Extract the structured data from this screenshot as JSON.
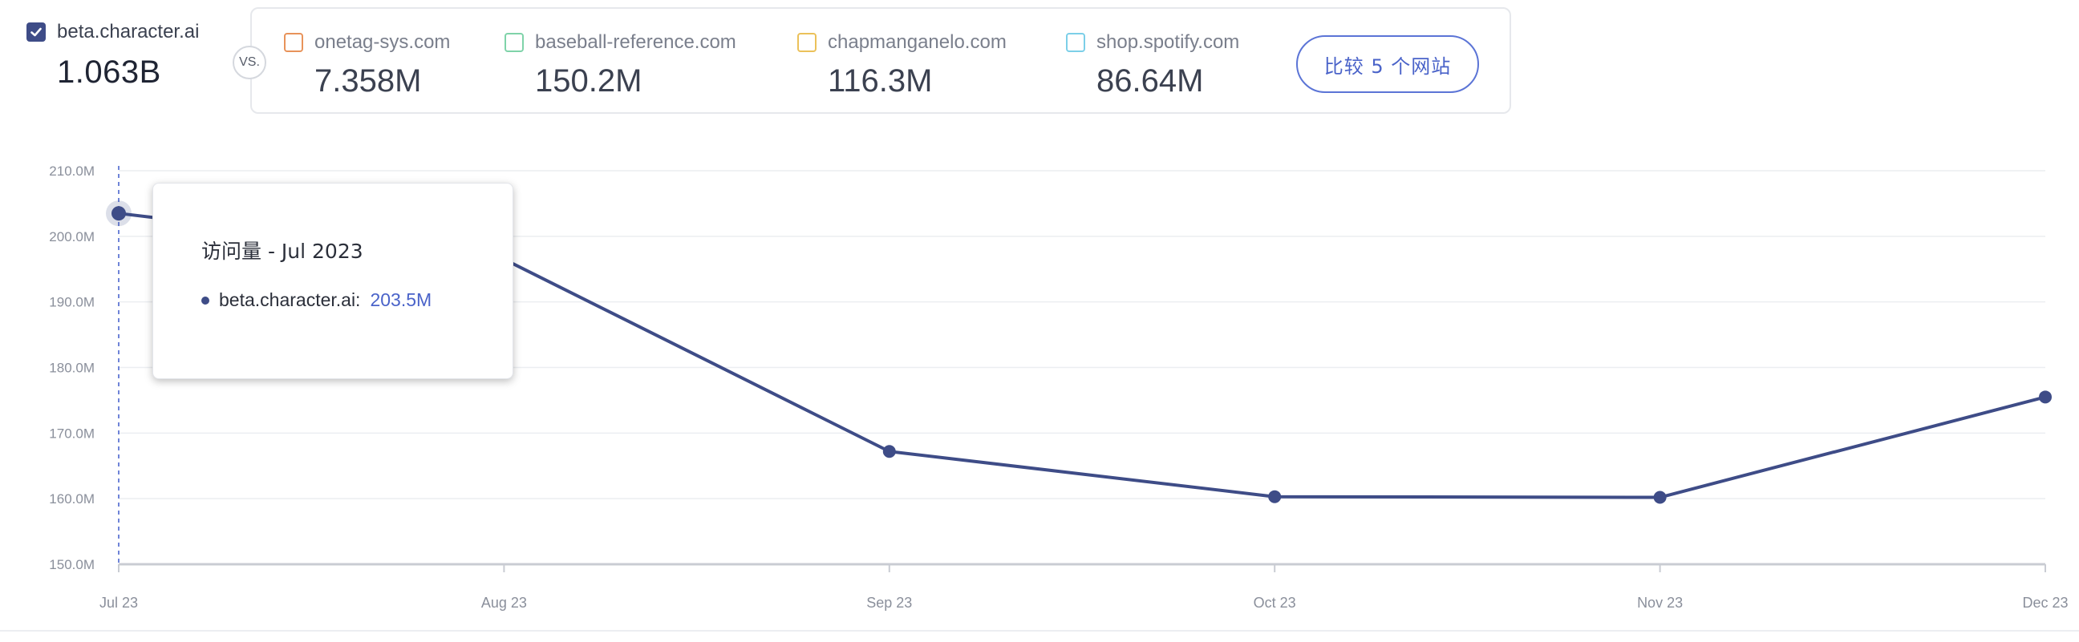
{
  "main_site": {
    "name": "beta.character.ai",
    "value": "1.063B",
    "checked": true
  },
  "vs_label": "VS.",
  "competitors": [
    {
      "name": "onetag-sys.com",
      "value": "7.358M",
      "color": "#e8935a"
    },
    {
      "name": "baseball-reference.com",
      "value": "150.2M",
      "color": "#7fd3a9"
    },
    {
      "name": "chapmanganelo.com",
      "value": "116.3M",
      "color": "#ebc15a"
    },
    {
      "name": "shop.spotify.com",
      "value": "86.64M",
      "color": "#7ccfe8"
    }
  ],
  "compare_button": "比较 5 个网站",
  "tooltip": {
    "title": "访问量 - Jul 2023",
    "site": "beta.character.ai:",
    "value": "203.5M"
  },
  "colors": {
    "series": "#3e4c87",
    "accent": "#4a63c9",
    "grid": "#eceef1"
  },
  "chart_data": {
    "type": "line",
    "categories": [
      "Jul 23",
      "Aug 23",
      "Sep 23",
      "Oct 23",
      "Nov 23",
      "Dec 23"
    ],
    "series": [
      {
        "name": "beta.character.ai",
        "values": [
          203.5,
          196.5,
          167.2,
          160.3,
          160.2,
          175.5
        ]
      }
    ],
    "ylim": [
      150,
      210
    ],
    "yticks": [
      150,
      160,
      170,
      180,
      190,
      200,
      210
    ],
    "ytick_labels": [
      "150.0M",
      "160.0M",
      "170.0M",
      "180.0M",
      "190.0M",
      "200.0M",
      "210.0M"
    ],
    "grid": true,
    "highlight_index": 0
  }
}
